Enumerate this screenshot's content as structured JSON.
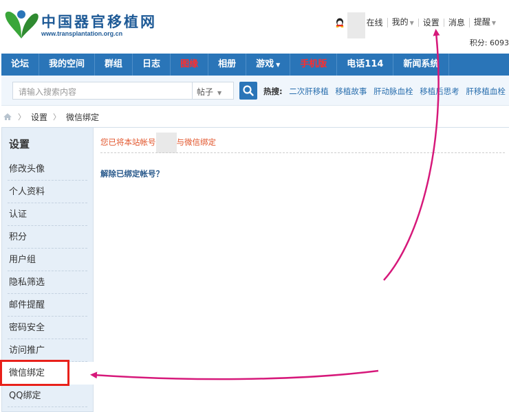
{
  "site": {
    "logo_title": "中国器官移植网",
    "logo_url": "www.transplantation.org.cn"
  },
  "userbar": {
    "online": "在线",
    "mine": "我的",
    "settings": "设置",
    "messages": "消息",
    "reminders": "提醒"
  },
  "points": "积分: 6093",
  "nav": [
    {
      "label": "论坛"
    },
    {
      "label": "我的空间"
    },
    {
      "label": "群组"
    },
    {
      "label": "日志"
    },
    {
      "label": "图缘"
    },
    {
      "label": "相册"
    },
    {
      "label": "游戏"
    },
    {
      "label": "手机版"
    },
    {
      "label": "电话114"
    },
    {
      "label": "新闻系统"
    }
  ],
  "search": {
    "placeholder": "请输入搜索内容",
    "type": "帖子",
    "hot_label": "热搜:",
    "hot_keywords": [
      "二次肝移植",
      "移植故事",
      "肝动脉血栓",
      "移植后思考",
      "肝移植血栓"
    ]
  },
  "breadcrumb": {
    "items": [
      "设置",
      "微信绑定"
    ]
  },
  "sidebar": {
    "title": "设置",
    "items": [
      {
        "label": "修改头像"
      },
      {
        "label": "个人资料"
      },
      {
        "label": "认证"
      },
      {
        "label": "积分"
      },
      {
        "label": "用户组"
      },
      {
        "label": "隐私筛选"
      },
      {
        "label": "邮件提醒"
      },
      {
        "label": "密码安全"
      },
      {
        "label": "访问推广"
      },
      {
        "label": "微信绑定"
      },
      {
        "label": "QQ绑定"
      }
    ]
  },
  "main": {
    "notice_prefix": "您已将本站帐号",
    "notice_suffix": "与微信绑定",
    "unbind_label": "解除已绑定帐号？"
  },
  "colors": {
    "nav_bg": "#2a75b8",
    "annotation": "#d6187a",
    "highlight": "#e8201a"
  }
}
